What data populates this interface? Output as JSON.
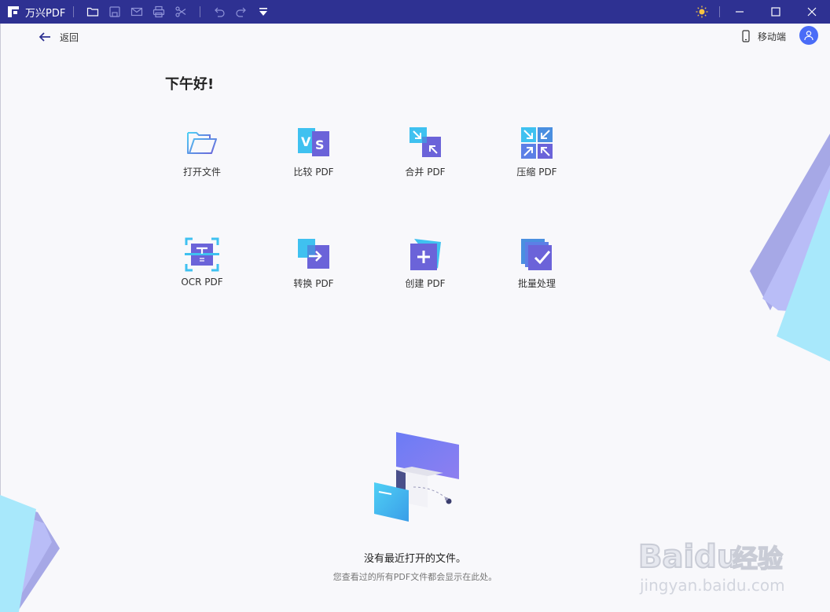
{
  "titlebar": {
    "app_name": "万兴PDF",
    "toolbar_icons": [
      "folder-icon",
      "save-icon",
      "mail-icon",
      "print-icon",
      "cut-icon",
      "undo-icon",
      "redo-icon",
      "dropdown-icon"
    ],
    "right_icons": [
      "theme-sun-icon",
      "minimize-icon",
      "maximize-icon",
      "close-icon"
    ],
    "bg_color": "#2e3192"
  },
  "header": {
    "back_label": "返回",
    "mobile_label": "移动端"
  },
  "greeting": "下午好!",
  "tools": [
    {
      "label": "打开文件",
      "icon": "open-file-icon"
    },
    {
      "label": "比较 PDF",
      "icon": "compare-pdf-icon"
    },
    {
      "label": "合并 PDF",
      "icon": "merge-pdf-icon"
    },
    {
      "label": "压缩 PDF",
      "icon": "compress-pdf-icon"
    },
    {
      "label": "OCR PDF",
      "icon": "ocr-pdf-icon"
    },
    {
      "label": "转换 PDF",
      "icon": "convert-pdf-icon"
    },
    {
      "label": "创建 PDF",
      "icon": "create-pdf-icon"
    },
    {
      "label": "批量处理",
      "icon": "batch-process-icon"
    }
  ],
  "empty_state": {
    "title": "没有最近打开的文件。",
    "subtitle": "您查看过的所有PDF文件都会显示在此处。"
  },
  "watermark": {
    "brand": "Baidu",
    "brand_suffix": "经验",
    "url": "jingyan.baidu.com"
  },
  "colors": {
    "accent": "#4a6cf7",
    "purple": "#6b63d9",
    "cyan": "#3fc1f0"
  }
}
